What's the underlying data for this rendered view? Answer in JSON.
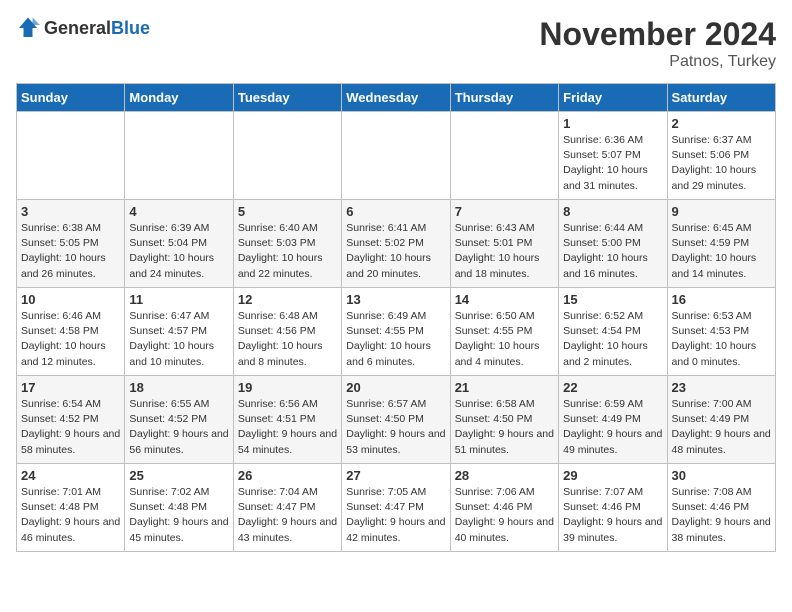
{
  "logo": {
    "general": "General",
    "blue": "Blue"
  },
  "title": {
    "month": "November 2024",
    "location": "Patnos, Turkey"
  },
  "weekdays": [
    "Sunday",
    "Monday",
    "Tuesday",
    "Wednesday",
    "Thursday",
    "Friday",
    "Saturday"
  ],
  "weeks": [
    [
      {
        "day": "",
        "info": ""
      },
      {
        "day": "",
        "info": ""
      },
      {
        "day": "",
        "info": ""
      },
      {
        "day": "",
        "info": ""
      },
      {
        "day": "",
        "info": ""
      },
      {
        "day": "1",
        "info": "Sunrise: 6:36 AM\nSunset: 5:07 PM\nDaylight: 10 hours and 31 minutes."
      },
      {
        "day": "2",
        "info": "Sunrise: 6:37 AM\nSunset: 5:06 PM\nDaylight: 10 hours and 29 minutes."
      }
    ],
    [
      {
        "day": "3",
        "info": "Sunrise: 6:38 AM\nSunset: 5:05 PM\nDaylight: 10 hours and 26 minutes."
      },
      {
        "day": "4",
        "info": "Sunrise: 6:39 AM\nSunset: 5:04 PM\nDaylight: 10 hours and 24 minutes."
      },
      {
        "day": "5",
        "info": "Sunrise: 6:40 AM\nSunset: 5:03 PM\nDaylight: 10 hours and 22 minutes."
      },
      {
        "day": "6",
        "info": "Sunrise: 6:41 AM\nSunset: 5:02 PM\nDaylight: 10 hours and 20 minutes."
      },
      {
        "day": "7",
        "info": "Sunrise: 6:43 AM\nSunset: 5:01 PM\nDaylight: 10 hours and 18 minutes."
      },
      {
        "day": "8",
        "info": "Sunrise: 6:44 AM\nSunset: 5:00 PM\nDaylight: 10 hours and 16 minutes."
      },
      {
        "day": "9",
        "info": "Sunrise: 6:45 AM\nSunset: 4:59 PM\nDaylight: 10 hours and 14 minutes."
      }
    ],
    [
      {
        "day": "10",
        "info": "Sunrise: 6:46 AM\nSunset: 4:58 PM\nDaylight: 10 hours and 12 minutes."
      },
      {
        "day": "11",
        "info": "Sunrise: 6:47 AM\nSunset: 4:57 PM\nDaylight: 10 hours and 10 minutes."
      },
      {
        "day": "12",
        "info": "Sunrise: 6:48 AM\nSunset: 4:56 PM\nDaylight: 10 hours and 8 minutes."
      },
      {
        "day": "13",
        "info": "Sunrise: 6:49 AM\nSunset: 4:55 PM\nDaylight: 10 hours and 6 minutes."
      },
      {
        "day": "14",
        "info": "Sunrise: 6:50 AM\nSunset: 4:55 PM\nDaylight: 10 hours and 4 minutes."
      },
      {
        "day": "15",
        "info": "Sunrise: 6:52 AM\nSunset: 4:54 PM\nDaylight: 10 hours and 2 minutes."
      },
      {
        "day": "16",
        "info": "Sunrise: 6:53 AM\nSunset: 4:53 PM\nDaylight: 10 hours and 0 minutes."
      }
    ],
    [
      {
        "day": "17",
        "info": "Sunrise: 6:54 AM\nSunset: 4:52 PM\nDaylight: 9 hours and 58 minutes."
      },
      {
        "day": "18",
        "info": "Sunrise: 6:55 AM\nSunset: 4:52 PM\nDaylight: 9 hours and 56 minutes."
      },
      {
        "day": "19",
        "info": "Sunrise: 6:56 AM\nSunset: 4:51 PM\nDaylight: 9 hours and 54 minutes."
      },
      {
        "day": "20",
        "info": "Sunrise: 6:57 AM\nSunset: 4:50 PM\nDaylight: 9 hours and 53 minutes."
      },
      {
        "day": "21",
        "info": "Sunrise: 6:58 AM\nSunset: 4:50 PM\nDaylight: 9 hours and 51 minutes."
      },
      {
        "day": "22",
        "info": "Sunrise: 6:59 AM\nSunset: 4:49 PM\nDaylight: 9 hours and 49 minutes."
      },
      {
        "day": "23",
        "info": "Sunrise: 7:00 AM\nSunset: 4:49 PM\nDaylight: 9 hours and 48 minutes."
      }
    ],
    [
      {
        "day": "24",
        "info": "Sunrise: 7:01 AM\nSunset: 4:48 PM\nDaylight: 9 hours and 46 minutes."
      },
      {
        "day": "25",
        "info": "Sunrise: 7:02 AM\nSunset: 4:48 PM\nDaylight: 9 hours and 45 minutes."
      },
      {
        "day": "26",
        "info": "Sunrise: 7:04 AM\nSunset: 4:47 PM\nDaylight: 9 hours and 43 minutes."
      },
      {
        "day": "27",
        "info": "Sunrise: 7:05 AM\nSunset: 4:47 PM\nDaylight: 9 hours and 42 minutes."
      },
      {
        "day": "28",
        "info": "Sunrise: 7:06 AM\nSunset: 4:46 PM\nDaylight: 9 hours and 40 minutes."
      },
      {
        "day": "29",
        "info": "Sunrise: 7:07 AM\nSunset: 4:46 PM\nDaylight: 9 hours and 39 minutes."
      },
      {
        "day": "30",
        "info": "Sunrise: 7:08 AM\nSunset: 4:46 PM\nDaylight: 9 hours and 38 minutes."
      }
    ]
  ]
}
